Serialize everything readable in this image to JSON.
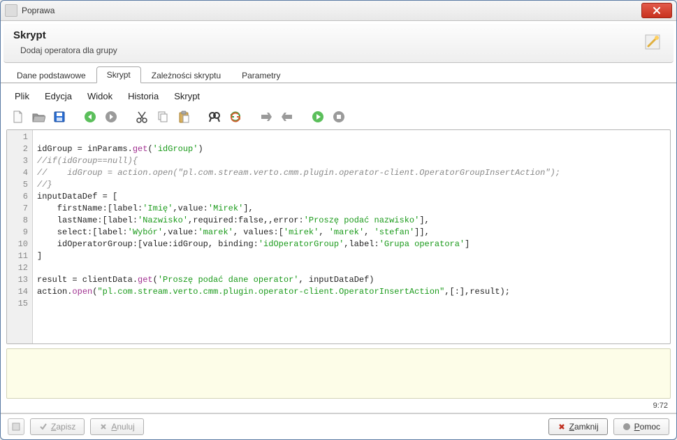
{
  "window": {
    "title": "Poprawa"
  },
  "header": {
    "title": "Skrypt",
    "subtitle": "Dodaj operatora dla grupy"
  },
  "tabs": [
    {
      "label": "Dane podstawowe",
      "active": false
    },
    {
      "label": "Skrypt",
      "active": true
    },
    {
      "label": "Zależności skryptu",
      "active": false
    },
    {
      "label": "Parametry",
      "active": false
    }
  ],
  "menubar": [
    {
      "label": "Plik"
    },
    {
      "label": "Edycja"
    },
    {
      "label": "Widok"
    },
    {
      "label": "Historia"
    },
    {
      "label": "Skrypt"
    }
  ],
  "toolbar_icons": [
    "new-icon",
    "open-icon",
    "save-icon",
    "undo-icon",
    "redo-icon",
    "cut-icon",
    "copy-icon",
    "paste-icon",
    "find-icon",
    "refresh-icon",
    "next-icon",
    "prev-icon",
    "run-icon",
    "stop-icon"
  ],
  "code_lines": [
    {
      "n": 1,
      "tokens": []
    },
    {
      "n": 2,
      "tokens": [
        {
          "t": "idGroup = inParams."
        },
        {
          "t": "get",
          "c": "tok-method"
        },
        {
          "t": "("
        },
        {
          "t": "'idGroup'",
          "c": "tok-str"
        },
        {
          "t": ")"
        }
      ]
    },
    {
      "n": 3,
      "tokens": [
        {
          "t": "//if(idGroup==null){",
          "c": "tok-comment"
        }
      ]
    },
    {
      "n": 4,
      "tokens": [
        {
          "t": "//    idGroup = action.open(\"pl.com.stream.verto.cmm.plugin.operator-client.OperatorGroupInsertAction\");",
          "c": "tok-comment"
        }
      ]
    },
    {
      "n": 5,
      "tokens": [
        {
          "t": "//}",
          "c": "tok-comment"
        }
      ]
    },
    {
      "n": 6,
      "tokens": [
        {
          "t": "inputDataDef = ["
        }
      ]
    },
    {
      "n": 7,
      "tokens": [
        {
          "t": "    firstName:[label:"
        },
        {
          "t": "'Imię'",
          "c": "tok-str"
        },
        {
          "t": ",value:"
        },
        {
          "t": "'Mirek'",
          "c": "tok-str"
        },
        {
          "t": "],"
        }
      ]
    },
    {
      "n": 8,
      "tokens": [
        {
          "t": "    lastName:[label:"
        },
        {
          "t": "'Nazwisko'",
          "c": "tok-str"
        },
        {
          "t": ",required:false,,error:"
        },
        {
          "t": "'Proszę podać nazwisko'",
          "c": "tok-str"
        },
        {
          "t": "],"
        }
      ]
    },
    {
      "n": 9,
      "tokens": [
        {
          "t": "    select:[label:"
        },
        {
          "t": "'Wybór'",
          "c": "tok-str"
        },
        {
          "t": ",value:"
        },
        {
          "t": "'marek'",
          "c": "tok-str"
        },
        {
          "t": ", values:["
        },
        {
          "t": "'mirek'",
          "c": "tok-str"
        },
        {
          "t": ", "
        },
        {
          "t": "'marek'",
          "c": "tok-str"
        },
        {
          "t": ", "
        },
        {
          "t": "'stefan'",
          "c": "tok-str"
        },
        {
          "t": "]],"
        }
      ]
    },
    {
      "n": 10,
      "tokens": [
        {
          "t": "    idOperatorGroup:[value:idGroup, binding:"
        },
        {
          "t": "'idOperatorGroup'",
          "c": "tok-str"
        },
        {
          "t": ",label:"
        },
        {
          "t": "'Grupa operatora'",
          "c": "tok-str"
        },
        {
          "t": "]"
        }
      ]
    },
    {
      "n": 11,
      "tokens": [
        {
          "t": "]"
        }
      ]
    },
    {
      "n": 12,
      "tokens": []
    },
    {
      "n": 13,
      "tokens": [
        {
          "t": "result = clientData."
        },
        {
          "t": "get",
          "c": "tok-method"
        },
        {
          "t": "("
        },
        {
          "t": "'Proszę podać dane operator'",
          "c": "tok-str"
        },
        {
          "t": ", inputDataDef)"
        }
      ]
    },
    {
      "n": 14,
      "tokens": [
        {
          "t": "action."
        },
        {
          "t": "open",
          "c": "tok-method"
        },
        {
          "t": "("
        },
        {
          "t": "\"pl.com.stream.verto.cmm.plugin.operator-client.OperatorInsertAction\"",
          "c": "tok-str"
        },
        {
          "t": ",[:],result);"
        }
      ]
    },
    {
      "n": 15,
      "tokens": []
    }
  ],
  "status": {
    "cursor": "9:72"
  },
  "footer": {
    "save": "Zapisz",
    "cancel": "Anuluj",
    "close": "Zamknij",
    "help": "Pomoc"
  }
}
